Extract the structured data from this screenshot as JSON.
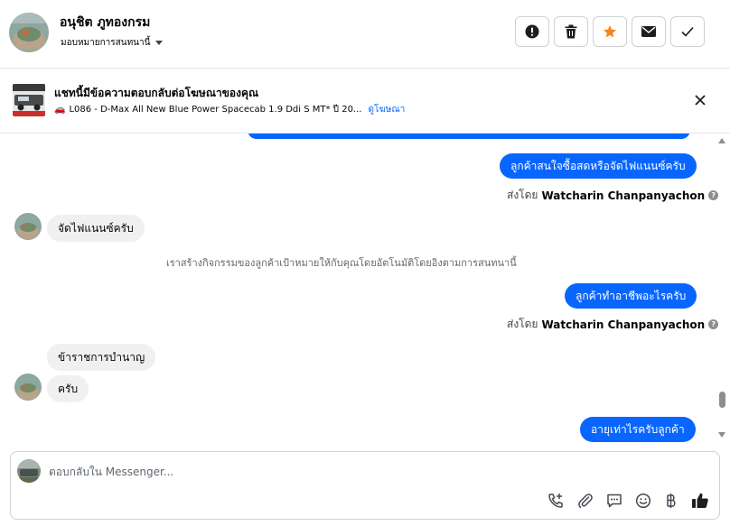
{
  "header": {
    "contact_name": "อนุชิต ภูทองกรม",
    "assign_label": "มอบหมายการสนทนานี้",
    "actions": [
      "report-icon",
      "trash-icon",
      "star-icon",
      "envelope-icon",
      "check-icon"
    ],
    "star_color": "#f5851f"
  },
  "ad": {
    "title": "แชทนี้มีข้อความตอบกลับต่อโฆษณาของคุณ",
    "emoji": "🚗",
    "subtitle": "L086 - D-Max All New Blue Power Spacecab 1.9 Ddi S MT* ปี 20...",
    "link_label": "ดูโฆษณา"
  },
  "messages": {
    "out_1": "ลูกค้าสนใจซื้อสดหรือจัดไฟแนนซ์ครับ",
    "sent_by_1_prefix": "ส่งโดย",
    "sent_by_1_name": "Watcharin Chanpanyachon",
    "in_1": "จัดไฟแนนซ์ครับ",
    "system_note": "เราสร้างกิจกรรมของลูกค้าเป้าหมายให้กับคุณโดยอัตโนมัติโดยอิงตามการสนทนานี้",
    "out_2": "ลูกค้าทำอาชีพอะไรครับ",
    "sent_by_2_prefix": "ส่งโดย",
    "sent_by_2_name": "Watcharin Chanpanyachon",
    "in_2": "ข้าราชการบำนาญ",
    "in_3": "ครับ",
    "out_3": "อายุเท่าไรครับลูกค้า",
    "info_symbol": "?"
  },
  "composer": {
    "placeholder": "ตอบกลับใน Messenger...",
    "tools": [
      "add-call-icon",
      "attachment-icon",
      "saved-reply-icon",
      "emoji-icon",
      "baht-payment-icon",
      "like-icon"
    ]
  },
  "colors": {
    "accent": "#0866ff",
    "incoming_bubble": "#f0f0f0",
    "divider": "#e4e6eb"
  }
}
